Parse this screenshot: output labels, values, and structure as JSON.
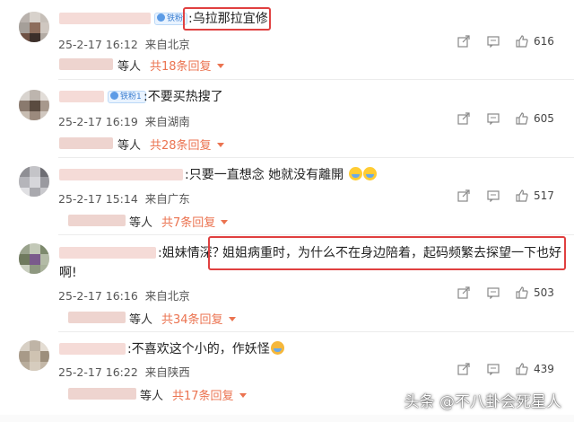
{
  "comments": [
    {
      "badge": "铁粉",
      "text": ":乌拉那拉宜修",
      "date": "25-2-17 16:12",
      "location": "来自北京",
      "likes": "616",
      "replies_who": "等人",
      "replies_count": "共18条回复"
    },
    {
      "badge": "铁粉1",
      "text": ":不要买热搜了",
      "date": "25-2-17 16:19",
      "location": "来自湖南",
      "likes": "605",
      "replies_who": "等人",
      "replies_count": "共28条回复"
    },
    {
      "text": ":只要一直想念 她就没有離開",
      "date": "25-2-17 15:14",
      "location": "来自广东",
      "likes": "517",
      "replies_who": "等人",
      "replies_count": "共7条回复"
    },
    {
      "text_prefix": ":姐妹情深？",
      "text_highlight": "姐姐病重时，为什么不在身边陪着，起码频繁去探望一下也好",
      "text_rest": "啊!",
      "date": "25-2-17 16:16",
      "location": "来自北京",
      "likes": "503",
      "replies_who": "等人",
      "replies_count": "共34条回复"
    },
    {
      "text": ":不喜欢这个小的，作妖怪",
      "date": "25-2-17 16:22",
      "location": "来自陕西",
      "likes": "439",
      "replies_who": "等人",
      "replies_count": "共17条回复"
    }
  ],
  "watermark": "头条 @不八卦会死星人",
  "colors": {
    "highlight": "#e04040",
    "reply_link": "#eb7350",
    "badge": "#3c7fd0"
  }
}
